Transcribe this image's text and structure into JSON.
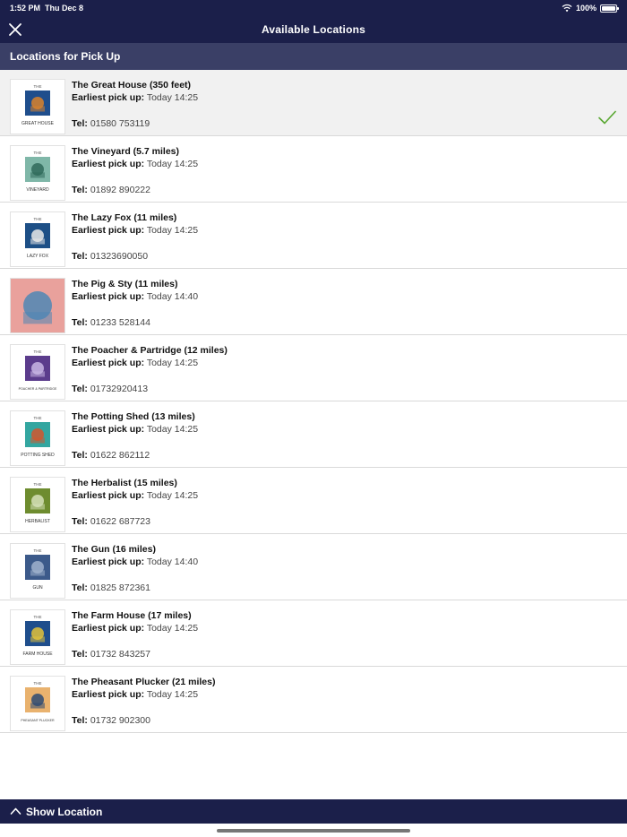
{
  "status": {
    "time": "1:52 PM",
    "date": "Thu Dec 8",
    "battery": "100%"
  },
  "nav": {
    "title": "Available Locations"
  },
  "section": {
    "title": "Locations for Pick Up"
  },
  "labels": {
    "earliest": "Earliest pick up:",
    "tel": "Tel:"
  },
  "locations": [
    {
      "name": "The Great House (350 feet)",
      "pickup": "Today 14:25",
      "tel": "01580 753119",
      "selected": true,
      "logo_top": "THE",
      "logo_bottom": "GREAT HOUSE",
      "logo_color": "#1f4e8c",
      "logo_accent": "#d9822b"
    },
    {
      "name": "The Vineyard (5.7 miles)",
      "pickup": "Today 14:25",
      "tel": "01892 890222",
      "selected": false,
      "logo_top": "THE",
      "logo_bottom": "VINEYARD",
      "logo_color": "#7fb7a8",
      "logo_accent": "#2f6a5a"
    },
    {
      "name": "The Lazy Fox (11 miles)",
      "pickup": "Today 14:25",
      "tel": "01323690050",
      "selected": false,
      "logo_top": "THE",
      "logo_bottom": "LAZY FOX",
      "logo_color": "#1d4f86",
      "logo_accent": "#e8e8e8"
    },
    {
      "name": "The Pig & Sty (11 miles)",
      "pickup": "Today 14:40",
      "tel": "01233 528144",
      "selected": false,
      "logo_top": "",
      "logo_bottom": "",
      "logo_color": "#e9a19c",
      "logo_accent": "#4f87b5"
    },
    {
      "name": "The Poacher & Partridge (12 miles)",
      "pickup": "Today 14:25",
      "tel": "01732920413",
      "selected": false,
      "logo_top": "THE",
      "logo_bottom": "POACHER & PARTRIDGE",
      "logo_color": "#5b3c8c",
      "logo_accent": "#c9b6e4"
    },
    {
      "name": "The Potting Shed (13 miles)",
      "pickup": "Today 14:25",
      "tel": "01622 862112",
      "selected": false,
      "logo_top": "THE",
      "logo_bottom": "POTTING SHED",
      "logo_color": "#33a6a0",
      "logo_accent": "#d2562e"
    },
    {
      "name": "The Herbalist (15 miles)",
      "pickup": "Today 14:25",
      "tel": "01622 687723",
      "selected": false,
      "logo_top": "THE",
      "logo_bottom": "HERBALIST",
      "logo_color": "#6e8c2f",
      "logo_accent": "#d6e0b8"
    },
    {
      "name": "The Gun (16 miles)",
      "pickup": "Today 14:40",
      "tel": "01825 872361",
      "selected": false,
      "logo_top": "THE",
      "logo_bottom": "GUN",
      "logo_color": "#3c5a8a",
      "logo_accent": "#9fb2cc"
    },
    {
      "name": "The Farm House (17 miles)",
      "pickup": "Today 14:25",
      "tel": "01732 843257",
      "selected": false,
      "logo_top": "THE",
      "logo_bottom": "FARM HOUSE",
      "logo_color": "#1f4e8c",
      "logo_accent": "#e2c23a"
    },
    {
      "name": "The Pheasant Plucker (21 miles)",
      "pickup": "Today 14:25",
      "tel": "01732 902300",
      "selected": false,
      "logo_top": "THE",
      "logo_bottom": "PHEASANT PLUCKER",
      "logo_color": "#e9b26e",
      "logo_accent": "#2d4a73"
    }
  ],
  "bottom": {
    "label": "Show Location"
  },
  "icons": {
    "close": "close-icon",
    "check": "checkmark-icon",
    "chevron": "chevron-up-icon",
    "wifi": "wifi-icon",
    "battery": "battery-icon"
  },
  "colors": {
    "nav": "#1b1f4a",
    "section": "#3a3f66",
    "check": "#5aa832",
    "selected_row": "#f1f1f1"
  }
}
